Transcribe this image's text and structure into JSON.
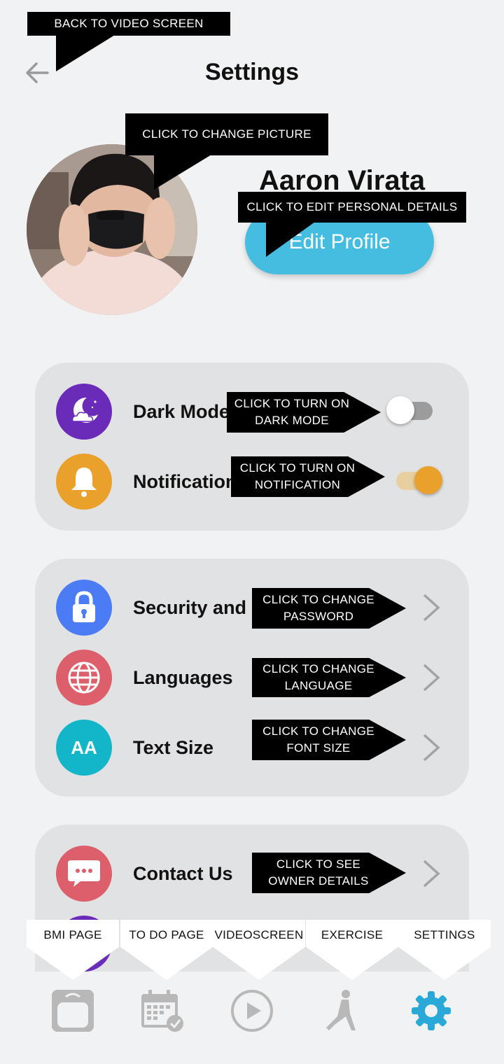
{
  "header": {
    "title": "Settings",
    "back_icon": "arrow-left-icon"
  },
  "profile": {
    "name": "Aaron Virata",
    "edit_label": "Edit Profile",
    "accent": "#45bde0"
  },
  "preferences": [
    {
      "label": "Dark Mode",
      "icon": "moon-cloud-icon",
      "icon_color": "#6a2bb8",
      "toggle": false
    },
    {
      "label": "Notification",
      "icon": "bell-icon",
      "icon_color": "#e9a12c",
      "toggle": true
    }
  ],
  "account": [
    {
      "label": "Security and Privacy",
      "icon": "lock-icon",
      "icon_color": "#4b7bf5"
    },
    {
      "label": "Languages",
      "icon": "globe-icon",
      "icon_color": "#dc5f6b"
    },
    {
      "label": "Text Size",
      "icon": "text-size-icon",
      "icon_color": "#12b6c8",
      "icon_text": "AA"
    }
  ],
  "support": [
    {
      "label": "Contact Us",
      "icon": "chat-icon",
      "icon_color": "#dc5f6b"
    }
  ],
  "callouts": {
    "back": "BACK TO VIDEO SCREEN",
    "picture": "CLICK TO CHANGE PICTURE",
    "edit": "CLICK TO EDIT PERSONAL DETAILS",
    "dark_mode": [
      "CLICK TO TURN ON",
      "DARK MODE"
    ],
    "notification": [
      "CLICK TO TURN ON",
      "NOTIFICATION"
    ],
    "password": [
      "CLICK TO CHANGE",
      "PASSWORD"
    ],
    "language": [
      "CLICK TO CHANGE",
      "LANGUAGE"
    ],
    "font": [
      "CLICK TO CHANGE",
      "FONT SIZE"
    ],
    "contact": [
      "CLICK TO SEE",
      "OWNER DETAILS"
    ]
  },
  "bottom_nav": [
    {
      "tip": "BMI PAGE",
      "icon": "scale-icon"
    },
    {
      "tip": "TO DO PAGE",
      "icon": "calendar-check-icon"
    },
    {
      "tip": "VIDEOSCREEN",
      "icon": "play-circle-icon"
    },
    {
      "tip": "EXERCISE",
      "icon": "lunge-person-icon"
    },
    {
      "tip": "SETTINGS",
      "icon": "gear-icon",
      "active": true,
      "active_color": "#29a9d8"
    }
  ]
}
